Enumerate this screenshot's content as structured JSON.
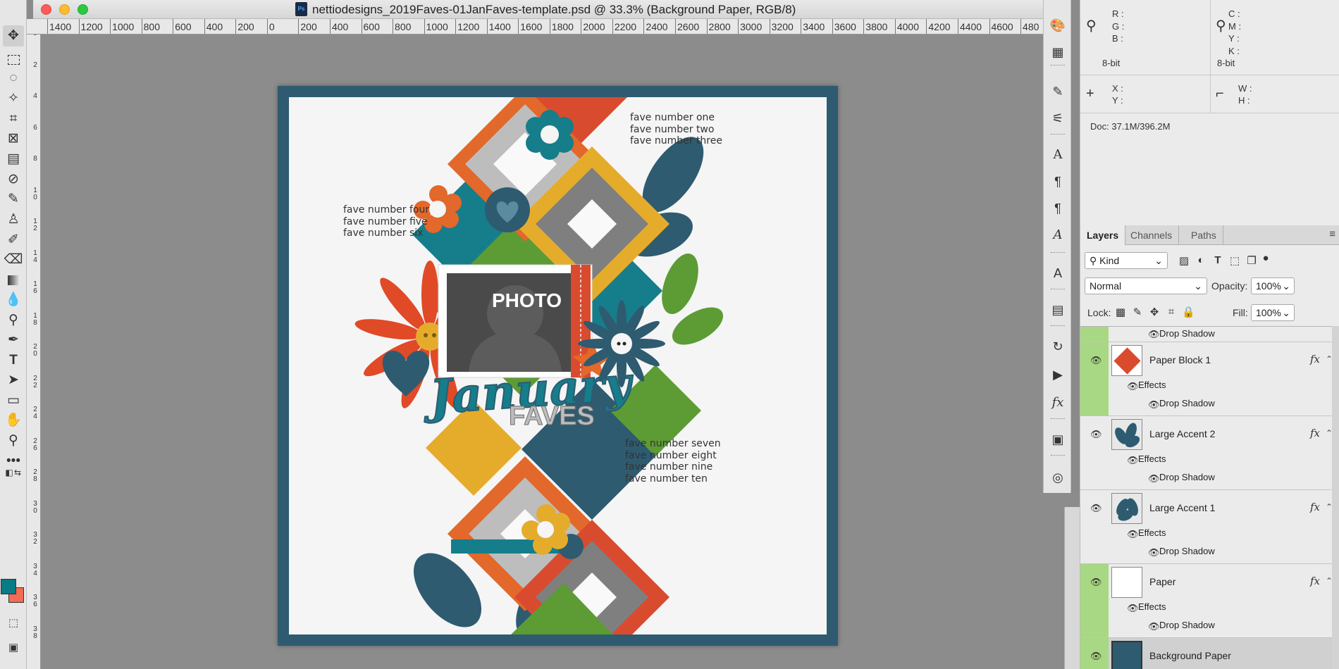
{
  "window": {
    "title": "nettiodesigns_2019Faves-01JanFaves-template.psd @ 33.3% (Background Paper, RGB/8)"
  },
  "colors": {
    "foreground": "#0a7a87",
    "background": "#f26b55",
    "frame": "#2e5b70",
    "teal": "#167d8b",
    "orange": "#e2682b",
    "red": "#d94b2e",
    "yellow": "#e5ac2c",
    "green": "#5d9b35",
    "gray": "#bdbdbd",
    "navy": "#2e5b70"
  },
  "ruler": {
    "horizontal": [
      "1400",
      "1200",
      "1000",
      "800",
      "600",
      "400",
      "200",
      "0",
      "200",
      "400",
      "600",
      "800",
      "1000",
      "1200",
      "1400",
      "1600",
      "1800",
      "2000",
      "2200",
      "2400",
      "2600",
      "2800",
      "3000",
      "3200",
      "3400",
      "3600",
      "3800",
      "4000",
      "4200",
      "4400",
      "4600",
      "480"
    ],
    "vertical": [
      "0",
      "2",
      "4",
      "6",
      "8",
      "1 0",
      "1 2",
      "1 4",
      "1 6",
      "1 8",
      "2 0",
      "2 2",
      "2 4",
      "2 6",
      "2 8",
      "3 0",
      "3 2",
      "3 4",
      "3 6",
      "3 8"
    ]
  },
  "document": {
    "photo_label": "PHOTO",
    "title_script": "January",
    "title_block": "FAVES",
    "faves_top": [
      "fave number one",
      "fave number two",
      "fave number three"
    ],
    "faves_left": [
      "fave number four",
      "fave number five",
      "fave number six"
    ],
    "faves_bottom": [
      "fave number seven",
      "fave number eight",
      "fave number nine",
      "fave number ten"
    ]
  },
  "info": {
    "rgb": [
      "R :",
      "G :",
      "B :"
    ],
    "cmyk": [
      "C :",
      "M :",
      "Y :",
      "K :"
    ],
    "bit_left": "8-bit",
    "bit_right": "8-bit",
    "xy": [
      "X :",
      "Y :"
    ],
    "wh": [
      "W :",
      "H :"
    ],
    "doc_size": "Doc: 37.1M/396.2M"
  },
  "layers_panel": {
    "tabs": [
      "Layers",
      "Channels",
      "Paths"
    ],
    "kind_filter": "Kind",
    "blend_mode": "Normal",
    "opacity_label": "Opacity:",
    "opacity_value": "100%",
    "lock_label": "Lock:",
    "fill_label": "Fill:",
    "fill_value": "100%",
    "effects_label": "Effects",
    "drop_shadow_label": "Drop Shadow",
    "fx_label": "fx",
    "layers": [
      {
        "name": "Paper Block 1",
        "thumb": "red-diamond"
      },
      {
        "name": "Large Accent 2",
        "thumb": "leaves"
      },
      {
        "name": "Large Accent 1",
        "thumb": "leaves"
      },
      {
        "name": "Paper",
        "thumb": "white"
      },
      {
        "name": "Background Paper",
        "thumb": "navy"
      }
    ]
  }
}
